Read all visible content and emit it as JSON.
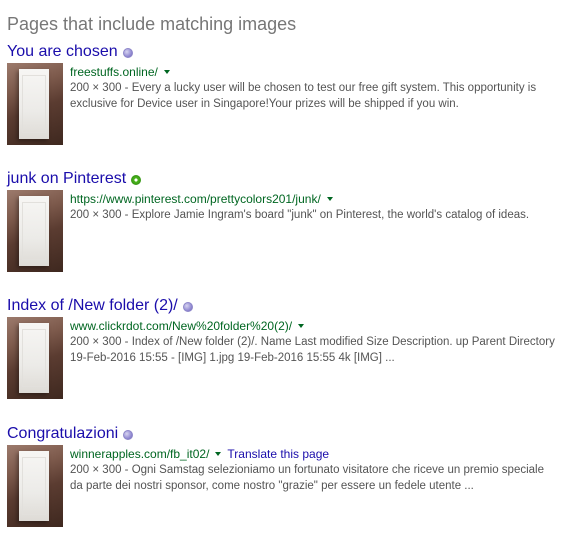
{
  "heading": "Pages that include matching images",
  "results": [
    {
      "title": "You are chosen",
      "url": "freestuffs.online/",
      "snippet": "200 × 300 - Every a lucky user will be chosen to test our free gift system. This opportunity is exclusive for Device user in Singapore!Your prizes will be shipped if you win."
    },
    {
      "title": "junk on Pinterest",
      "url": "https://www.pinterest.com/prettycolors201/junk/",
      "snippet": "200 × 300 - Explore Jamie Ingram's board \"junk\" on Pinterest, the world's catalog of ideas."
    },
    {
      "title": "Index of /New folder (2)/",
      "url": "www.clickrdot.com/New%20folder%20(2)/",
      "snippet": "200 × 300 - Index of /New folder (2)/. Name Last modified Size Description. up Parent Directory 19-Feb-2016 15:55 - [IMG] 1.jpg 19-Feb-2016 15:55 4k [IMG] ..."
    },
    {
      "title": "Congratulazioni",
      "url": "winnerapples.com/fb_it02/",
      "translate": "Translate this page",
      "snippet": "200 × 300 - Ogni Samstag selezioniamo un fortunato visitatore che riceve un premio speciale da parte dei nostri sponsor, come nostro \"grazie\" per essere un fedele utente ..."
    }
  ]
}
